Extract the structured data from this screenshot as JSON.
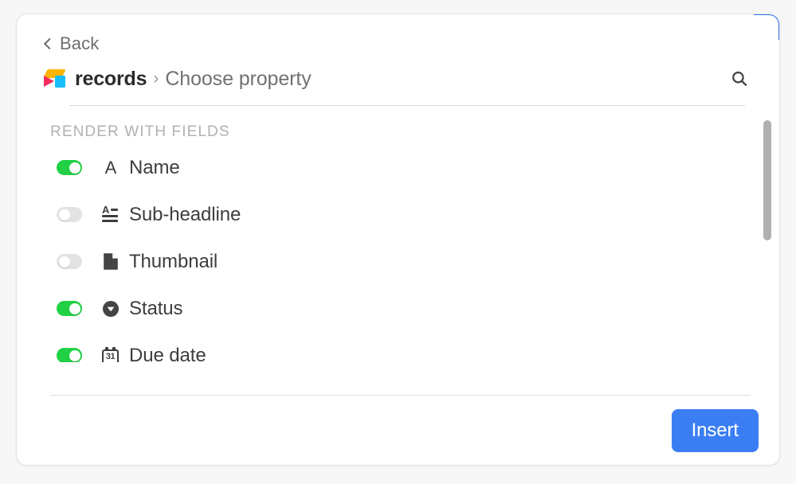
{
  "card": {
    "back": {
      "label": "Back",
      "icon": "chevron-left-icon"
    },
    "breadcrumb": {
      "app_icon": "airtable-cube-icon",
      "app_name": "records",
      "separator": "›",
      "current": "Choose property"
    },
    "search_icon": "search-icon"
  },
  "list": {
    "section_label": "RENDER WITH FIELDS",
    "fields": [
      {
        "name": "Name",
        "icon": "single-line-text-icon",
        "enabled": true,
        "toggle_state": "on"
      },
      {
        "name": "Sub-headline",
        "icon": "long-text-icon",
        "enabled": false,
        "toggle_state": "off"
      },
      {
        "name": "Thumbnail",
        "icon": "attachment-icon",
        "enabled": false,
        "toggle_state": "off"
      },
      {
        "name": "Status",
        "icon": "single-select-icon",
        "enabled": true,
        "toggle_state": "on"
      },
      {
        "name": "Due date",
        "icon": "calendar-icon",
        "enabled": true,
        "toggle_state": "on",
        "calendar_day": "31"
      }
    ]
  },
  "footer": {
    "insert_label": "Insert"
  },
  "colors": {
    "toggle_on": "#21d045",
    "toggle_off": "#e3e3e3",
    "primary_button": "#3b7ef3",
    "focus_ring": "#2f72f0",
    "logo_yellow": "#fcb400",
    "logo_blue": "#18bfff",
    "logo_pink": "#f82b60"
  }
}
